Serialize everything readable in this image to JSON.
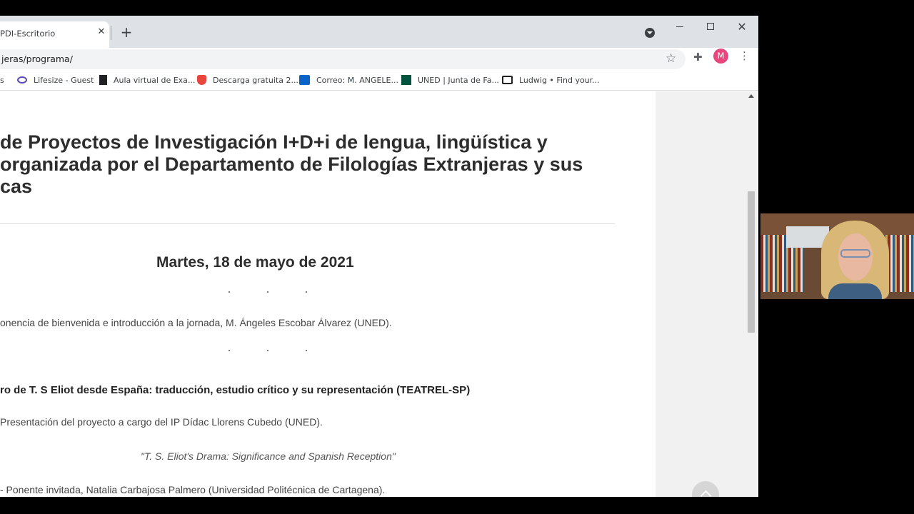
{
  "browser": {
    "tab_title": "PDI-Escritorio",
    "tab_close": "✕",
    "new_tab": "+",
    "window": {
      "close": "✕"
    },
    "url": "jeras/programa/",
    "avatar_letter": "M",
    "star_icon": "☆",
    "extensions_icon": "✚",
    "menu_icon": "⋮",
    "bookmarks": [
      {
        "label": "s",
        "icon": "folder-icon",
        "color": "#000000"
      },
      {
        "label": "Lifesize - Guest",
        "icon": "lifesize-icon",
        "color": "#5b4ab5"
      },
      {
        "label": "Aula virtual de Exa...",
        "icon": "document-icon",
        "color": "#202124"
      },
      {
        "label": "Descarga gratuita 2...",
        "icon": "shield-icon",
        "color": "#e8453c"
      },
      {
        "label": "Correo: M. ANGELE...",
        "icon": "outlook-icon",
        "color": "#0a64c8"
      },
      {
        "label": "UNED | Junta de Fa...",
        "icon": "uned-icon",
        "color": "#00533e"
      },
      {
        "label": "Ludwig • Find your...",
        "icon": "ludwig-icon",
        "color": "#202124"
      }
    ]
  },
  "page": {
    "heading_lines": [
      "de Proyectos de Investigación I+D+i de lengua, lingüística y",
      " organizada por el Departamento de Filologías Extranjeras y sus",
      "cas"
    ],
    "date": "Martes, 18 de mayo de 2021",
    "welcome": "onencia de bienvenida e introducción a la jornada, M. Ángeles Escobar Álvarez (UNED).",
    "project_title": "ro de T. S Eliot desde España: traducción, estudio crítico y su representación (TEATREL-SP)",
    "presentation": " Presentación del proyecto a cargo del IP Dídac Llorens Cubedo (UNED).",
    "quote": "\"T. S. Eliot's Drama: Significance and Spanish Reception\"",
    "speaker": "- Ponente invitada, Natalia Carbajosa Palmero (Universidad Politécnica de Cartagena)."
  }
}
